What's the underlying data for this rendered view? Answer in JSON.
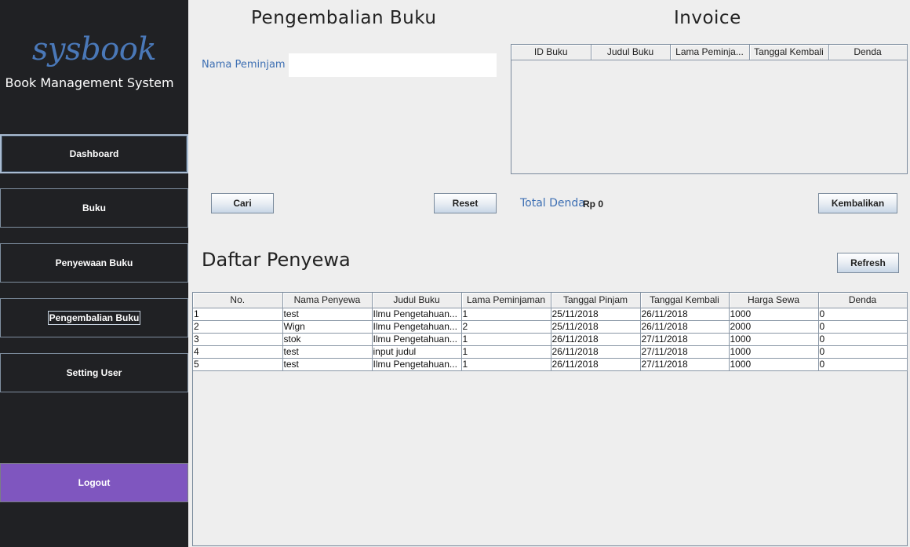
{
  "sidebar": {
    "logo": "sysbook",
    "subtitle": "Book Management System",
    "items": [
      {
        "label": "Dashboard"
      },
      {
        "label": "Buku"
      },
      {
        "label": "Penyewaan Buku"
      },
      {
        "label": "Pengembalian Buku"
      },
      {
        "label": "Setting User"
      }
    ],
    "logout_label": "Logout"
  },
  "colors": {
    "sidebar_bg": "#202124",
    "logo_blue": "#4a78b8",
    "label_blue": "#3d6fb3",
    "logout_purple": "#7f56bf"
  },
  "return_form": {
    "title": "Pengembalian Buku",
    "borrower_label": "Nama Peminjam",
    "borrower_value": "",
    "search_label": "Cari",
    "reset_label": "Reset"
  },
  "invoice": {
    "title": "Invoice",
    "columns": [
      "ID Buku",
      "Judul Buku",
      "Lama Peminja...",
      "Tanggal Kembali",
      "Denda"
    ],
    "rows": [],
    "total_label": "Total Denda",
    "total_value": "Rp 0",
    "return_label": "Kembalikan"
  },
  "renters": {
    "title": "Daftar Penyewa",
    "refresh_label": "Refresh",
    "columns": [
      "No.",
      "Nama Penyewa",
      "Judul Buku",
      "Lama Peminjaman",
      "Tanggal Pinjam",
      "Tanggal Kembali",
      "Harga Sewa",
      "Denda"
    ],
    "rows": [
      [
        "1",
        "test",
        "Ilmu Pengetahuan...",
        "1",
        "25/11/2018",
        "26/11/2018",
        "1000",
        "0"
      ],
      [
        "2",
        "Wign",
        "Ilmu Pengetahuan...",
        "2",
        "25/11/2018",
        "26/11/2018",
        "2000",
        "0"
      ],
      [
        "3",
        "stok",
        "Ilmu Pengetahuan...",
        "1",
        "26/11/2018",
        "27/11/2018",
        "1000",
        "0"
      ],
      [
        "4",
        "test",
        "input judul",
        "1",
        "26/11/2018",
        "27/11/2018",
        "1000",
        "0"
      ],
      [
        "5",
        "test",
        "Ilmu Pengetahuan...",
        "1",
        "26/11/2018",
        "27/11/2018",
        "1000",
        "0"
      ]
    ]
  }
}
